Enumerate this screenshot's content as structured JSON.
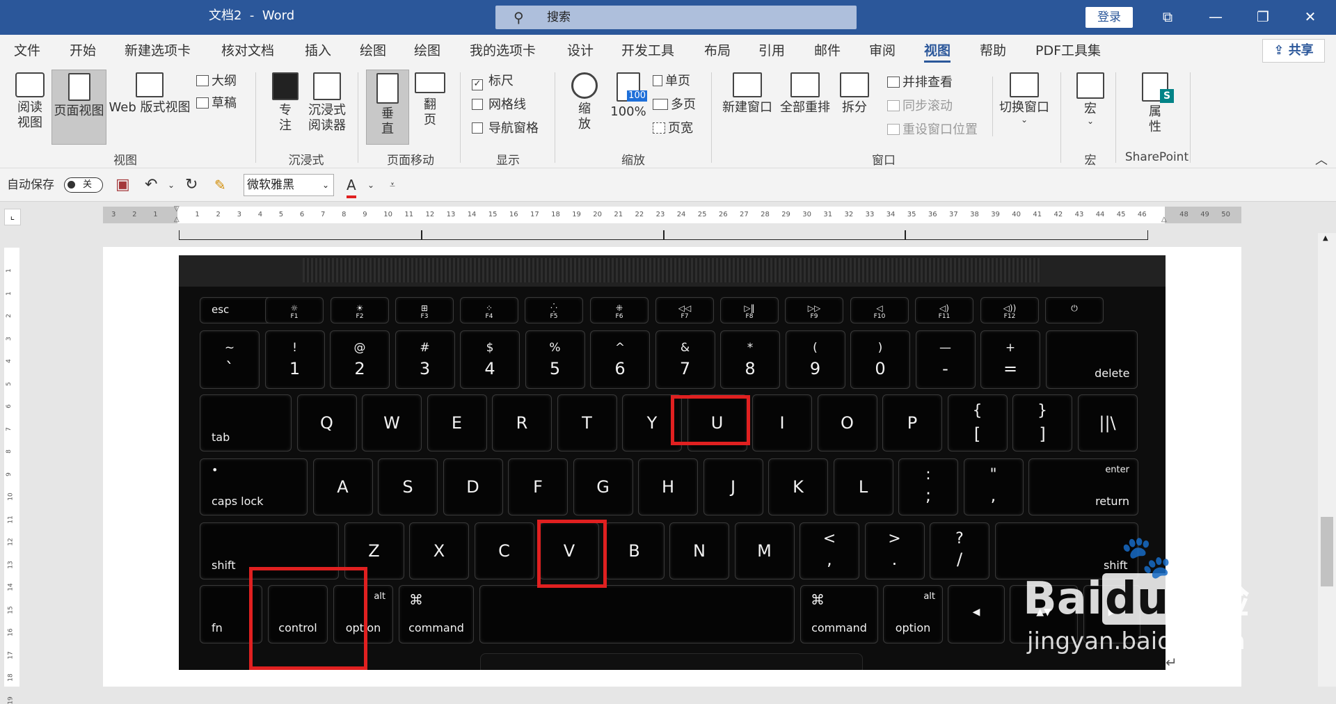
{
  "title": {
    "doc": "文档2",
    "sep": "-",
    "app": "Word"
  },
  "search": {
    "placeholder": "搜索"
  },
  "login": "登录",
  "window_controls": {
    "ribbon_display": "⧉",
    "minimize": "—",
    "restore": "❐",
    "close": "✕"
  },
  "menu": [
    "文件",
    "开始",
    "新建选项卡",
    "核对文档",
    "插入",
    "绘图",
    "绘图",
    "我的选项卡",
    "设计",
    "开发工具",
    "布局",
    "引用",
    "邮件",
    "审阅",
    "视图",
    "帮助",
    "PDF工具集"
  ],
  "menu_active": "视图",
  "share": "共享",
  "ribbon": {
    "view": {
      "read": "阅读视图",
      "page": "页面视图",
      "web": "Web 版式视图",
      "outline": "大纲",
      "draft": "草稿",
      "group": "视图"
    },
    "immersive": {
      "focus": "专注",
      "reader": "沉浸式阅读器",
      "group": "沉浸式"
    },
    "pagemove": {
      "vertical": "垂直",
      "flip": "翻页",
      "group": "页面移动"
    },
    "show": {
      "ruler": "标尺",
      "gridlines": "网格线",
      "navpane": "导航窗格",
      "group": "显示",
      "ruler_checked": true
    },
    "zoom": {
      "zoom": "缩放",
      "hundred": "100%",
      "badge": "100",
      "onepage": "单页",
      "multipage": "多页",
      "pagewidth": "页宽",
      "group": "缩放"
    },
    "window": {
      "newwin": "新建窗口",
      "arrange": "全部重排",
      "split": "拆分",
      "sidebyside": "并排查看",
      "syncscroll": "同步滚动",
      "resetpos": "重设窗口位置",
      "switch": "切换窗口",
      "group": "窗口"
    },
    "macro": {
      "macro": "宏",
      "group": "宏"
    },
    "sharepoint": {
      "props": "属性",
      "group": "SharePoint",
      "badge": "S"
    }
  },
  "qat": {
    "autosave": "自动保存",
    "toggle": "关",
    "font": "微软雅黑",
    "fontcolor_letter": "A"
  },
  "ruler_numbers": [
    "3",
    "2",
    "1",
    "",
    "1",
    "2",
    "3",
    "4",
    "5",
    "6",
    "7",
    "8",
    "9",
    "10",
    "11",
    "12",
    "13",
    "14",
    "15",
    "16",
    "17",
    "18",
    "19",
    "20",
    "21",
    "22",
    "23",
    "24",
    "25",
    "26",
    "27",
    "28",
    "29",
    "30",
    "31",
    "32",
    "33",
    "34",
    "35",
    "36",
    "37",
    "38",
    "39",
    "40",
    "41",
    "42",
    "43",
    "44",
    "45",
    "46",
    "",
    "48",
    "49",
    "50"
  ],
  "vruler_numbers": [
    "1",
    "1",
    "2",
    "3",
    "4",
    "5",
    "6",
    "7",
    "8",
    "9",
    "10",
    "11",
    "12",
    "13",
    "14",
    "15",
    "16",
    "17",
    "18",
    "19"
  ],
  "keyboard": {
    "fn_row": [
      {
        "main": "esc",
        "sub": ""
      },
      {
        "main": "☼",
        "sub": "F1"
      },
      {
        "main": "☀",
        "sub": "F2"
      },
      {
        "main": "⊞",
        "sub": "F3"
      },
      {
        "main": "⁘",
        "sub": "F4"
      },
      {
        "main": "⁛",
        "sub": "F5"
      },
      {
        "main": "⁜",
        "sub": "F6"
      },
      {
        "main": "◁◁",
        "sub": "F7"
      },
      {
        "main": "▷‖",
        "sub": "F8"
      },
      {
        "main": "▷▷",
        "sub": "F9"
      },
      {
        "main": "◁",
        "sub": "F10"
      },
      {
        "main": "◁)",
        "sub": "F11"
      },
      {
        "main": "◁))",
        "sub": "F12"
      },
      {
        "main": "⏻",
        "sub": ""
      }
    ],
    "num_row": [
      {
        "up": "~",
        "main": "`"
      },
      {
        "up": "!",
        "main": "1"
      },
      {
        "up": "@",
        "main": "2"
      },
      {
        "up": "#",
        "main": "3"
      },
      {
        "up": "$",
        "main": "4"
      },
      {
        "up": "%",
        "main": "5"
      },
      {
        "up": "^",
        "main": "6"
      },
      {
        "up": "&",
        "main": "7"
      },
      {
        "up": "*",
        "main": "8"
      },
      {
        "up": "(",
        "main": "9"
      },
      {
        "up": ")",
        "main": "0"
      },
      {
        "up": "—",
        "main": "-"
      },
      {
        "up": "+",
        "main": "="
      },
      {
        "up": "",
        "main": "delete"
      }
    ],
    "q_row": [
      "tab",
      "Q",
      "W",
      "E",
      "R",
      "T",
      "Y",
      "U",
      "I",
      "O",
      "P",
      "{|[",
      "}|]",
      "||\\"
    ],
    "a_row": [
      "caps lock",
      "A",
      "S",
      "D",
      "F",
      "G",
      "H",
      "J",
      "K",
      "L",
      ":|;",
      "\"|,",
      "enter|return"
    ],
    "z_row": [
      "shift",
      "Z",
      "X",
      "C",
      "V",
      "B",
      "N",
      "M",
      "<|,",
      ">|.",
      "?|/",
      "shift"
    ],
    "bottom_row": [
      {
        "up": "",
        "main": "fn"
      },
      {
        "up": "",
        "main": "control"
      },
      {
        "up": "alt",
        "main": "option"
      },
      {
        "up": "⌘",
        "main": "command"
      },
      {
        "up": "",
        "main": ""
      },
      {
        "up": "⌘",
        "main": "command"
      },
      {
        "up": "alt",
        "main": "option"
      },
      {
        "up": "",
        "main": "◀"
      },
      {
        "up": "",
        "main": "▲▼"
      },
      {
        "up": "",
        "main": "▶"
      }
    ],
    "caps_dot": "•"
  },
  "watermark": {
    "brand_bai": "Bai",
    "brand_du": "du",
    "brand_cn": "经验",
    "url": "jingyan.baidu.com"
  },
  "paragraph_mark": "↵"
}
